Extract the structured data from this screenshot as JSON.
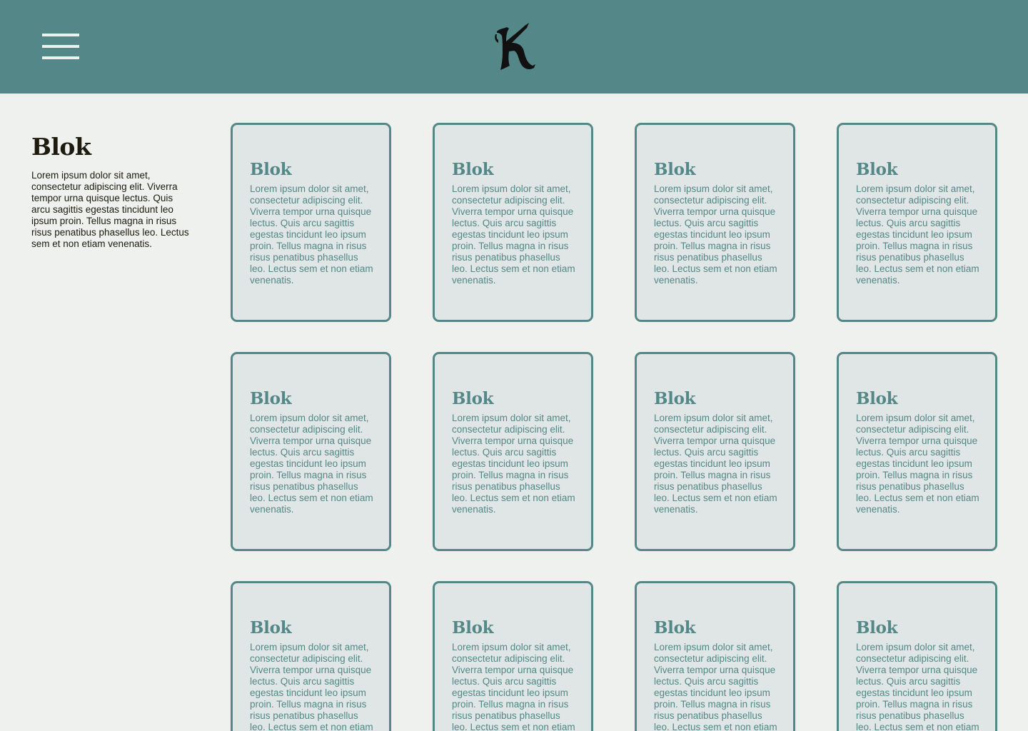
{
  "header": {
    "menu_icon": "hamburger-menu-icon",
    "logo_letter": "K",
    "logo_alt": "blackletter-k-logo"
  },
  "intro": {
    "title": "Blok",
    "body": "Lorem ipsum dolor sit amet, consectetur adipiscing elit. Viverra tempor urna quisque lectus. Quis arcu sagittis egestas tincidunt leo ipsum proin. Tellus magna in risus risus penatibus phasellus leo. Lectus sem et non etiam venenatis."
  },
  "cards": [
    {
      "title": "Blok",
      "body": "Lorem ipsum dolor sit amet, consectetur adipiscing elit. Viverra tempor urna quisque lectus. Quis arcu sagittis egestas tincidunt leo ipsum proin. Tellus magna in risus risus penatibus phasellus leo. Lectus sem et non etiam venenatis."
    },
    {
      "title": "Blok",
      "body": "Lorem ipsum dolor sit amet, consectetur adipiscing elit. Viverra tempor urna quisque lectus. Quis arcu sagittis egestas tincidunt leo ipsum proin. Tellus magna in risus risus penatibus phasellus leo. Lectus sem et non etiam venenatis."
    },
    {
      "title": "Blok",
      "body": "Lorem ipsum dolor sit amet, consectetur adipiscing elit. Viverra tempor urna quisque lectus. Quis arcu sagittis egestas tincidunt leo ipsum proin. Tellus magna in risus risus penatibus phasellus leo. Lectus sem et non etiam venenatis."
    },
    {
      "title": "Blok",
      "body": "Lorem ipsum dolor sit amet, consectetur adipiscing elit. Viverra tempor urna quisque lectus. Quis arcu sagittis egestas tincidunt leo ipsum proin. Tellus magna in risus risus penatibus phasellus leo. Lectus sem et non etiam venenatis."
    },
    {
      "title": "Blok",
      "body": "Lorem ipsum dolor sit amet, consectetur adipiscing elit. Viverra tempor urna quisque lectus. Quis arcu sagittis egestas tincidunt leo ipsum proin. Tellus magna in risus risus penatibus phasellus leo. Lectus sem et non etiam venenatis."
    },
    {
      "title": "Blok",
      "body": "Lorem ipsum dolor sit amet, consectetur adipiscing elit. Viverra tempor urna quisque lectus. Quis arcu sagittis egestas tincidunt leo ipsum proin. Tellus magna in risus risus penatibus phasellus leo. Lectus sem et non etiam venenatis."
    },
    {
      "title": "Blok",
      "body": "Lorem ipsum dolor sit amet, consectetur adipiscing elit. Viverra tempor urna quisque lectus. Quis arcu sagittis egestas tincidunt leo ipsum proin. Tellus magna in risus risus penatibus phasellus leo. Lectus sem et non etiam venenatis."
    },
    {
      "title": "Blok",
      "body": "Lorem ipsum dolor sit amet, consectetur adipiscing elit. Viverra tempor urna quisque lectus. Quis arcu sagittis egestas tincidunt leo ipsum proin. Tellus magna in risus risus penatibus phasellus leo. Lectus sem et non etiam venenatis."
    },
    {
      "title": "Blok",
      "body": "Lorem ipsum dolor sit amet, consectetur adipiscing elit. Viverra tempor urna quisque lectus. Quis arcu sagittis egestas tincidunt leo ipsum proin. Tellus magna in risus risus penatibus phasellus leo. Lectus sem et non etiam venenatis."
    },
    {
      "title": "Blok",
      "body": "Lorem ipsum dolor sit amet, consectetur adipiscing elit. Viverra tempor urna quisque lectus. Quis arcu sagittis egestas tincidunt leo ipsum proin. Tellus magna in risus risus penatibus phasellus leo. Lectus sem et non etiam venenatis."
    },
    {
      "title": "Blok",
      "body": "Lorem ipsum dolor sit amet, consectetur adipiscing elit. Viverra tempor urna quisque lectus. Quis arcu sagittis egestas tincidunt leo ipsum proin. Tellus magna in risus risus penatibus phasellus leo. Lectus sem et non etiam venenatis."
    },
    {
      "title": "Blok",
      "body": "Lorem ipsum dolor sit amet, consectetur adipiscing elit. Viverra tempor urna quisque lectus. Quis arcu sagittis egestas tincidunt leo ipsum proin. Tellus magna in risus risus penatibus phasellus leo. Lectus sem et non etiam venenatis."
    }
  ],
  "colors": {
    "header": "#548787",
    "background": "#eef1ee",
    "card_fill": "#dfe6e5",
    "accent": "#548787",
    "dark_text": "#1e1a0e"
  }
}
